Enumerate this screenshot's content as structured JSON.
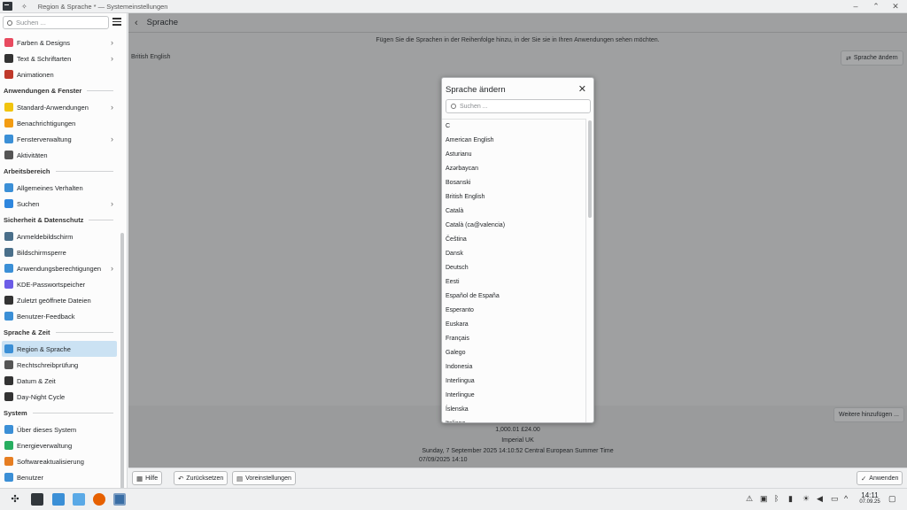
{
  "window": {
    "title": "Region & Sprache * — Systemeinstellungen",
    "controls": [
      "–",
      "⌃",
      "✕"
    ]
  },
  "sidebar": {
    "search_placeholder": "Suchen ...",
    "entries": [
      {
        "kind": "item",
        "label": "Farben & Designs",
        "icon": "colors-icon",
        "chevron": true
      },
      {
        "kind": "item",
        "label": "Text & Schriftarten",
        "icon": "fonts-icon",
        "chevron": true
      },
      {
        "kind": "item",
        "label": "Animationen",
        "icon": "animations-icon",
        "chevron": false
      },
      {
        "kind": "section",
        "label": "Anwendungen & Fenster"
      },
      {
        "kind": "item",
        "label": "Standard-Anwendungen",
        "icon": "star-icon",
        "chevron": true
      },
      {
        "kind": "item",
        "label": "Benachrichtigungen",
        "icon": "bell-icon",
        "chevron": false
      },
      {
        "kind": "item",
        "label": "Fensterverwaltung",
        "icon": "window-icon",
        "chevron": true
      },
      {
        "kind": "item",
        "label": "Aktivitäten",
        "icon": "activities-icon",
        "chevron": false
      },
      {
        "kind": "section",
        "label": "Arbeitsbereich"
      },
      {
        "kind": "item",
        "label": "Allgemeines Verhalten",
        "icon": "desktop-icon",
        "chevron": false
      },
      {
        "kind": "item",
        "label": "Suchen",
        "icon": "search-globe-icon",
        "chevron": true
      },
      {
        "kind": "section",
        "label": "Sicherheit & Datenschutz"
      },
      {
        "kind": "item",
        "label": "Anmeldebildschirm",
        "icon": "login-screen-icon",
        "chevron": false
      },
      {
        "kind": "item",
        "label": "Bildschirmsperre",
        "icon": "screen-lock-icon",
        "chevron": false
      },
      {
        "kind": "item",
        "label": "Anwendungsberechtigungen",
        "icon": "shield-icon",
        "chevron": true
      },
      {
        "kind": "item",
        "label": "KDE-Passwortspeicher",
        "icon": "wallet-icon",
        "chevron": false
      },
      {
        "kind": "item",
        "label": "Zuletzt geöffnete Dateien",
        "icon": "recent-files-icon",
        "chevron": false
      },
      {
        "kind": "item",
        "label": "Benutzer-Feedback",
        "icon": "feedback-icon",
        "chevron": false
      },
      {
        "kind": "section",
        "label": "Sprache & Zeit"
      },
      {
        "kind": "item",
        "label": "Region & Sprache",
        "icon": "region-icon",
        "chevron": false,
        "active": true
      },
      {
        "kind": "item",
        "label": "Rechtschreibprüfung",
        "icon": "spellcheck-icon",
        "chevron": false
      },
      {
        "kind": "item",
        "label": "Datum & Zeit",
        "icon": "clock-icon",
        "chevron": false
      },
      {
        "kind": "item",
        "label": "Day-Night Cycle",
        "icon": "day-night-icon",
        "chevron": false
      },
      {
        "kind": "section",
        "label": "System"
      },
      {
        "kind": "item",
        "label": "Über dieses System",
        "icon": "info-icon",
        "chevron": false
      },
      {
        "kind": "item",
        "label": "Energieverwaltung",
        "icon": "power-icon",
        "chevron": false
      },
      {
        "kind": "item",
        "label": "Softwareaktualisierung",
        "icon": "update-icon",
        "chevron": false
      },
      {
        "kind": "item",
        "label": "Benutzer",
        "icon": "user-icon",
        "chevron": false
      }
    ]
  },
  "main": {
    "back_glyph": "‹",
    "page_title": "Sprache",
    "info_text": "Fügen Sie die Sprachen in der Reihenfolge hinzu, in der Sie sie in Ihren Anwendungen sehen möchten.",
    "current_language": "British English",
    "change_language_button": "Sprache ändern",
    "add_more_button": "Weitere hinzufügen ...",
    "format_lines": [
      "1,000.01  £24.00",
      "Imperial UK",
      "Sunday, 7 September 2025 14:10:52 Central European Summer Time",
      "07/09/2025 14:10"
    ]
  },
  "bottom_bar": {
    "help": "Hilfe",
    "reset": "Zurücksetzen",
    "defaults": "Voreinstellungen",
    "apply": "Anwenden"
  },
  "dialog": {
    "title": "Sprache ändern",
    "close_glyph": "✕",
    "search_placeholder": "Suchen ...",
    "languages": [
      "C",
      "American English",
      "Asturianu",
      "Azərbaycan",
      "Bosanski",
      "British English",
      "Català",
      "Català (ca@valencia)",
      "Čeština",
      "Dansk",
      "Deutsch",
      "Eesti",
      "Español de España",
      "Esperanto",
      "Euskara",
      "Français",
      "Galego",
      "Indonesia",
      "Interlingua",
      "Interlingue",
      "Íslenska",
      "Italiano"
    ]
  },
  "taskbar": {
    "time": "14:11",
    "date": "07.09.25"
  }
}
